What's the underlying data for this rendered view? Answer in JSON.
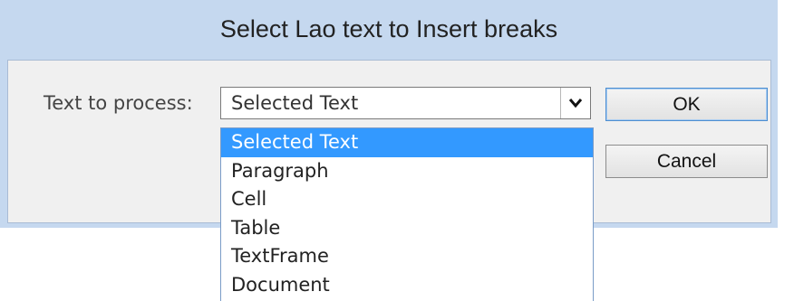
{
  "dialog": {
    "title": "Select Lao text to Insert breaks",
    "label": "Text to process:",
    "combo": {
      "value": "Selected Text",
      "arrow_icon": "chevron-down-icon"
    },
    "buttons": {
      "ok": "OK",
      "cancel": "Cancel"
    },
    "dropdown": {
      "selected_index": 0,
      "options": [
        "Selected Text",
        "Paragraph",
        "Cell",
        "Table",
        "TextFrame",
        "Document"
      ]
    }
  },
  "colors": {
    "title_bar": "#c5d8ef",
    "client_bg": "#f0f0f0",
    "highlight": "#3399ff"
  }
}
